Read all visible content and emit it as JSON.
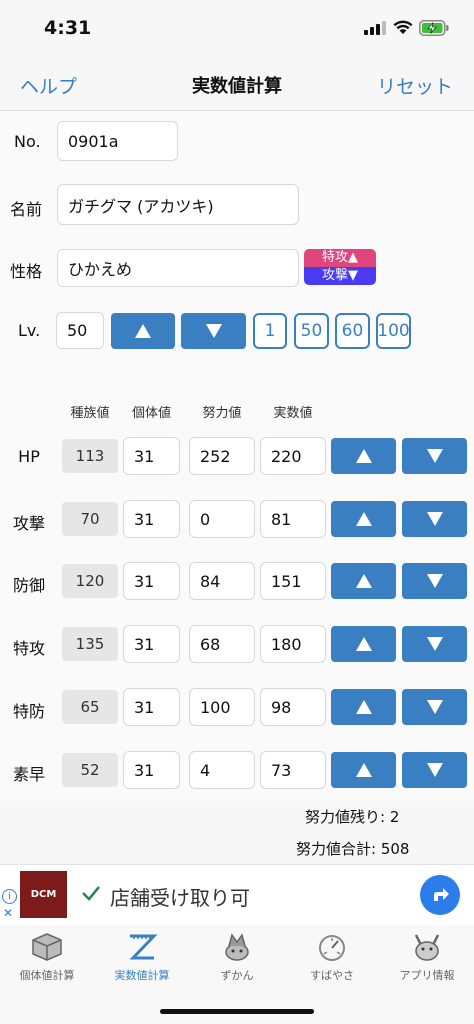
{
  "status": {
    "time": "4:31"
  },
  "nav": {
    "left": "ヘルプ",
    "title": "実数値計算",
    "right": "リセット"
  },
  "form": {
    "no_label": "No.",
    "no_value": "0901a",
    "name_label": "名前",
    "name_value": "ガチグマ (アカツキ)",
    "nature_label": "性格",
    "nature_value": "ひかえめ",
    "nature_up": "特攻▲",
    "nature_down": "攻撃▼",
    "level_label": "Lv.",
    "level_value": "50",
    "level_presets": [
      "1",
      "50",
      "60",
      "100"
    ]
  },
  "stats": {
    "headers": [
      "種族値",
      "個体値",
      "努力値",
      "実数値"
    ],
    "rows": [
      {
        "name": "HP",
        "base": "113",
        "iv": "31",
        "ev": "252",
        "actual": "220"
      },
      {
        "name": "攻撃",
        "base": "70",
        "iv": "31",
        "ev": "0",
        "actual": "81"
      },
      {
        "name": "防御",
        "base": "120",
        "iv": "31",
        "ev": "84",
        "actual": "151"
      },
      {
        "name": "特攻",
        "base": "135",
        "iv": "31",
        "ev": "68",
        "actual": "180"
      },
      {
        "name": "特防",
        "base": "65",
        "iv": "31",
        "ev": "100",
        "actual": "98"
      },
      {
        "name": "素早",
        "base": "52",
        "iv": "31",
        "ev": "4",
        "actual": "73"
      }
    ]
  },
  "summary": {
    "remaining": "努力値残り: 2",
    "total": "努力値合計: 508"
  },
  "ad": {
    "logo": "DCM",
    "text": "店舗受け取り可"
  },
  "tabs": [
    {
      "label": "個体値計算",
      "icon": "cube-icon",
      "active": false
    },
    {
      "label": "実数値計算",
      "icon": "ruler-z-icon",
      "active": true
    },
    {
      "label": "ずかん",
      "icon": "pokemon-icon",
      "active": false
    },
    {
      "label": "すばやさ",
      "icon": "speedometer-icon",
      "active": false
    },
    {
      "label": "アプリ情報",
      "icon": "pikachu-icon",
      "active": false
    }
  ],
  "colors": {
    "accent": "#3a7fc1",
    "nature_up": "#e0457e",
    "nature_down": "#4a3bf0",
    "battery": "#3cc13c"
  }
}
